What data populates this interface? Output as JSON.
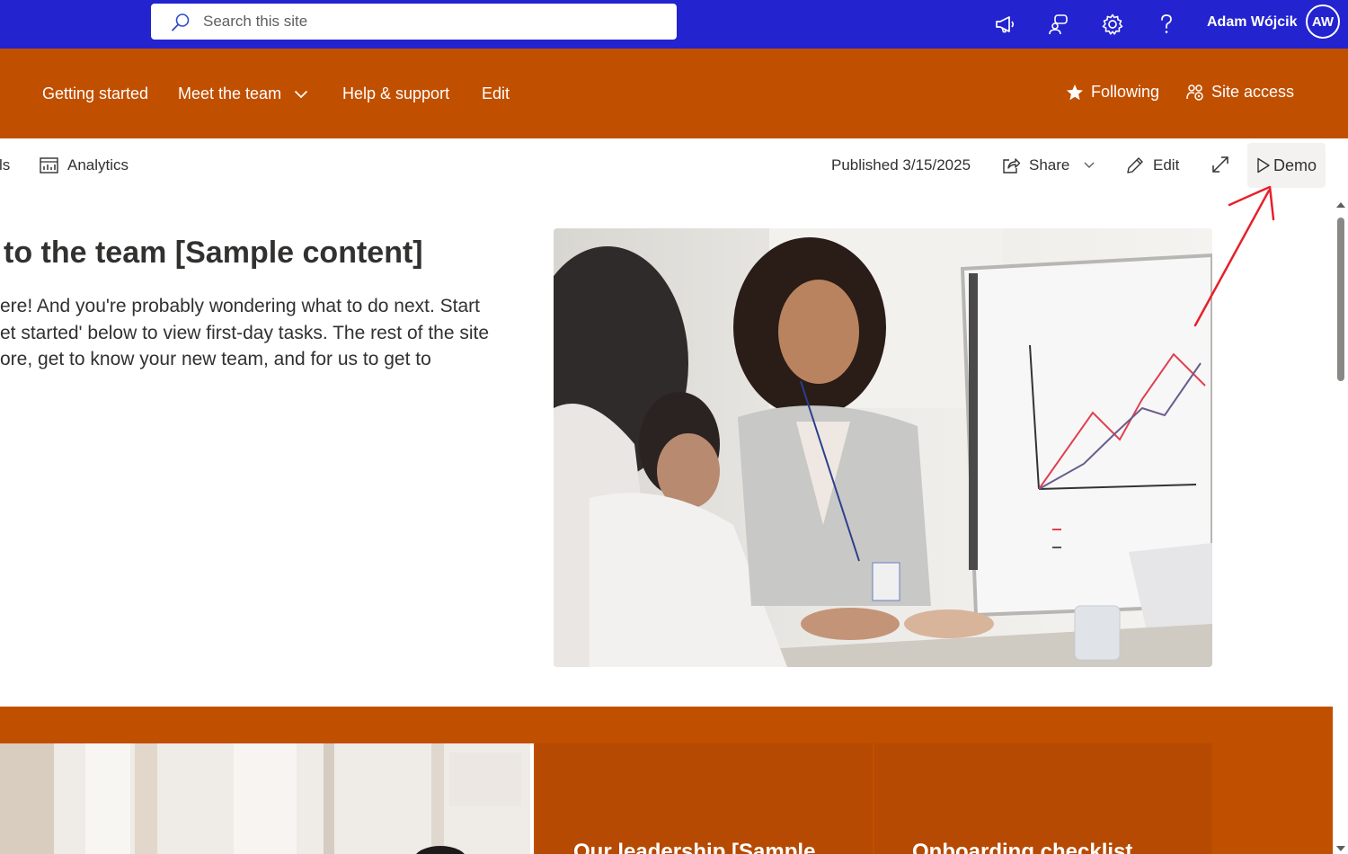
{
  "suite_bar": {
    "search_placeholder": "Search this site",
    "icons": [
      "megaphone-icon",
      "chat-icon",
      "settings-icon",
      "help-icon"
    ],
    "user_name": "Adam Wójcik",
    "user_initials": "AW",
    "color": "#2323d0"
  },
  "site_header": {
    "color": "#c14f00",
    "nav": {
      "getting_started": "Getting started",
      "meet_the_team": "Meet the team",
      "help_support": "Help & support",
      "edit": "Edit"
    },
    "following": "Following",
    "site_access": "Site access"
  },
  "command_bar": {
    "truncated_left": "ls",
    "analytics": "Analytics",
    "published": "Published 3/15/2025",
    "share": "Share",
    "edit": "Edit",
    "demo": "Demo"
  },
  "hero": {
    "title": "to the team [Sample content]",
    "body_lines": [
      "ere! And you're probably wondering what to do next. Start",
      "et started' below to view first-day tasks. The rest of the site",
      "ore, get to know your new team, and for us to get to"
    ],
    "image": "woman-presenting-chart-image"
  },
  "tiles": {
    "leadership": "Our leadership [Sample",
    "onboarding": "Onboarding checklist"
  },
  "annotation": {
    "type": "red-arrow",
    "color": "#e8202a",
    "target": "demo-button"
  }
}
